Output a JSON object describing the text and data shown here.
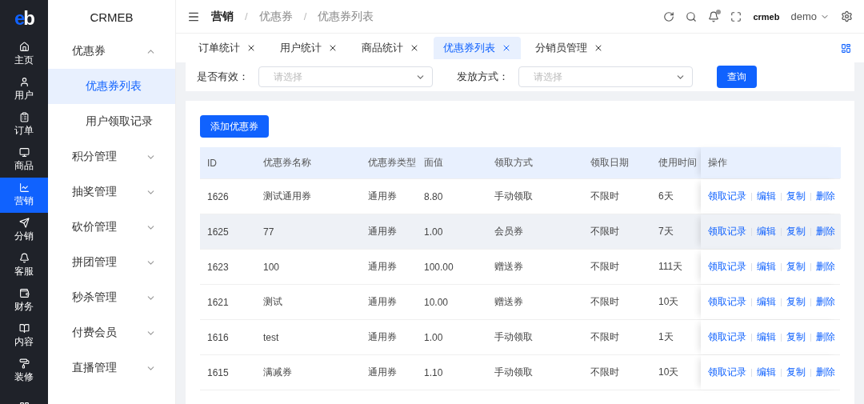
{
  "logo": {
    "text_1": "e",
    "text_2": "b"
  },
  "rail": [
    {
      "label": "主页",
      "selected": false
    },
    {
      "label": "用户",
      "selected": false
    },
    {
      "label": "订单",
      "selected": false
    },
    {
      "label": "商品",
      "selected": false
    },
    {
      "label": "营销",
      "selected": true
    },
    {
      "label": "分销",
      "selected": false
    },
    {
      "label": "客服",
      "selected": false
    },
    {
      "label": "财务",
      "selected": false
    },
    {
      "label": "内容",
      "selected": false
    },
    {
      "label": "装修",
      "selected": false
    },
    {
      "selected": false
    }
  ],
  "sidebar": {
    "title": "CRMEB",
    "items": [
      {
        "label": "优惠券",
        "expanded": true,
        "children": [
          {
            "label": "优惠券列表",
            "selected": true
          },
          {
            "label": "用户领取记录",
            "selected": false
          }
        ]
      },
      {
        "label": "积分管理",
        "expanded": false
      },
      {
        "label": "抽奖管理",
        "expanded": false
      },
      {
        "label": "砍价管理",
        "expanded": false
      },
      {
        "label": "拼团管理",
        "expanded": false
      },
      {
        "label": "秒杀管理",
        "expanded": false
      },
      {
        "label": "付费会员",
        "expanded": false
      },
      {
        "label": "直播管理",
        "expanded": false
      }
    ]
  },
  "breadcrumb": [
    "营销",
    "优惠券",
    "优惠券列表"
  ],
  "breadcrumb_separator": "/",
  "header": {
    "brand": "crmeb",
    "user": "demo",
    "has_notification": true
  },
  "tabs": [
    {
      "label": "订单统计",
      "selected": false
    },
    {
      "label": "用户统计",
      "selected": false
    },
    {
      "label": "商品统计",
      "selected": false
    },
    {
      "label": "优惠券列表",
      "selected": true
    },
    {
      "label": "分销员管理",
      "selected": false
    }
  ],
  "filters": [
    {
      "label": "是否有效：",
      "placeholder": "请选择"
    },
    {
      "label": "发放方式：",
      "placeholder": "请选择"
    }
  ],
  "query_button": "查询",
  "add_button": "添加优惠券",
  "table": {
    "columns": [
      "ID",
      "优惠券名称",
      "优惠券类型",
      "面值",
      "领取方式",
      "领取日期",
      "使用时间",
      "操作"
    ],
    "rows": [
      {
        "cells": [
          "1626",
          "测试通用券",
          "通用券",
          "8.80",
          "手动领取",
          "不限时",
          "6天"
        ],
        "actions": [
          "领取记录",
          "编辑",
          "复制",
          "删除"
        ],
        "selected": false
      },
      {
        "cells": [
          "1625",
          "77",
          "通用券",
          "1.00",
          "会员券",
          "不限时",
          "7天"
        ],
        "actions": [
          "领取记录",
          "编辑",
          "复制",
          "删除"
        ],
        "selected": true
      },
      {
        "cells": [
          "1623",
          "100",
          "通用券",
          "100.00",
          "赠送券",
          "不限时",
          "111天"
        ],
        "actions": [
          "领取记录",
          "编辑",
          "复制",
          "删除"
        ],
        "selected": false
      },
      {
        "cells": [
          "1621",
          "测试",
          "通用券",
          "10.00",
          "赠送券",
          "不限时",
          "10天"
        ],
        "actions": [
          "领取记录",
          "编辑",
          "复制",
          "删除"
        ],
        "selected": false
      },
      {
        "cells": [
          "1616",
          "test",
          "通用券",
          "1.00",
          "手动领取",
          "不限时",
          "1天"
        ],
        "actions": [
          "领取记录",
          "编辑",
          "复制",
          "删除"
        ],
        "selected": false
      },
      {
        "cells": [
          "1615",
          "满减券",
          "通用券",
          "1.10",
          "手动领取",
          "不限时",
          "10天"
        ],
        "actions": [
          "领取记录",
          "编辑",
          "复制",
          "删除"
        ],
        "selected": false
      }
    ]
  }
}
